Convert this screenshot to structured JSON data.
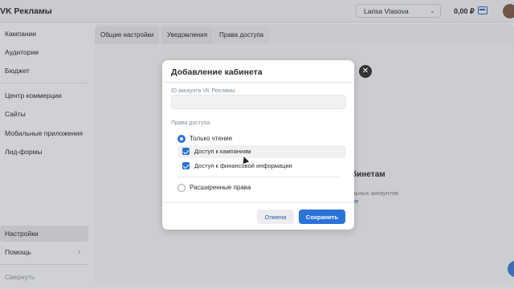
{
  "app": {
    "title": "VK Рекламы",
    "account": "Larisa Vlasova",
    "balance": "0,00 ₽"
  },
  "sidebar": {
    "items": [
      {
        "label": "Кампании"
      },
      {
        "label": "Аудитории"
      },
      {
        "label": "Бюджет"
      },
      {
        "label": "Центр коммерции"
      },
      {
        "label": "Сайты"
      },
      {
        "label": "Мобильные приложения"
      },
      {
        "label": "Лид-формы"
      },
      {
        "label": "Настройки"
      },
      {
        "label": "Помощь"
      },
      {
        "label": "Свернуть"
      }
    ]
  },
  "tabs": [
    {
      "label": "Общие настройки"
    },
    {
      "label": "Уведомления"
    },
    {
      "label": "Права доступа"
    }
  ],
  "background": {
    "heading_fragment": "бинетам",
    "sub_fragment": "льных аккаунтов",
    "link_fragment": "ее"
  },
  "modal": {
    "title": "Добавление кабинета",
    "id_label": "ID аккаунта VK Рекламы",
    "id_value": "",
    "rights_label": "Права доступа",
    "options": {
      "read_only": "Только чтение",
      "campaigns_access": "Доступ к кампаниям",
      "finance_access": "Доступ к финансовой информации",
      "extended": "Расширенные права"
    },
    "cancel_label": "Отмена",
    "save_label": "Сохранить"
  },
  "colors": {
    "accent": "#2a72d8",
    "close_button": "#333333"
  },
  "icons": {
    "close": "close-icon",
    "wallet": "wallet-icon",
    "chevron_down": "chevron-down-icon",
    "chevron_right": "chevron-right-icon"
  }
}
